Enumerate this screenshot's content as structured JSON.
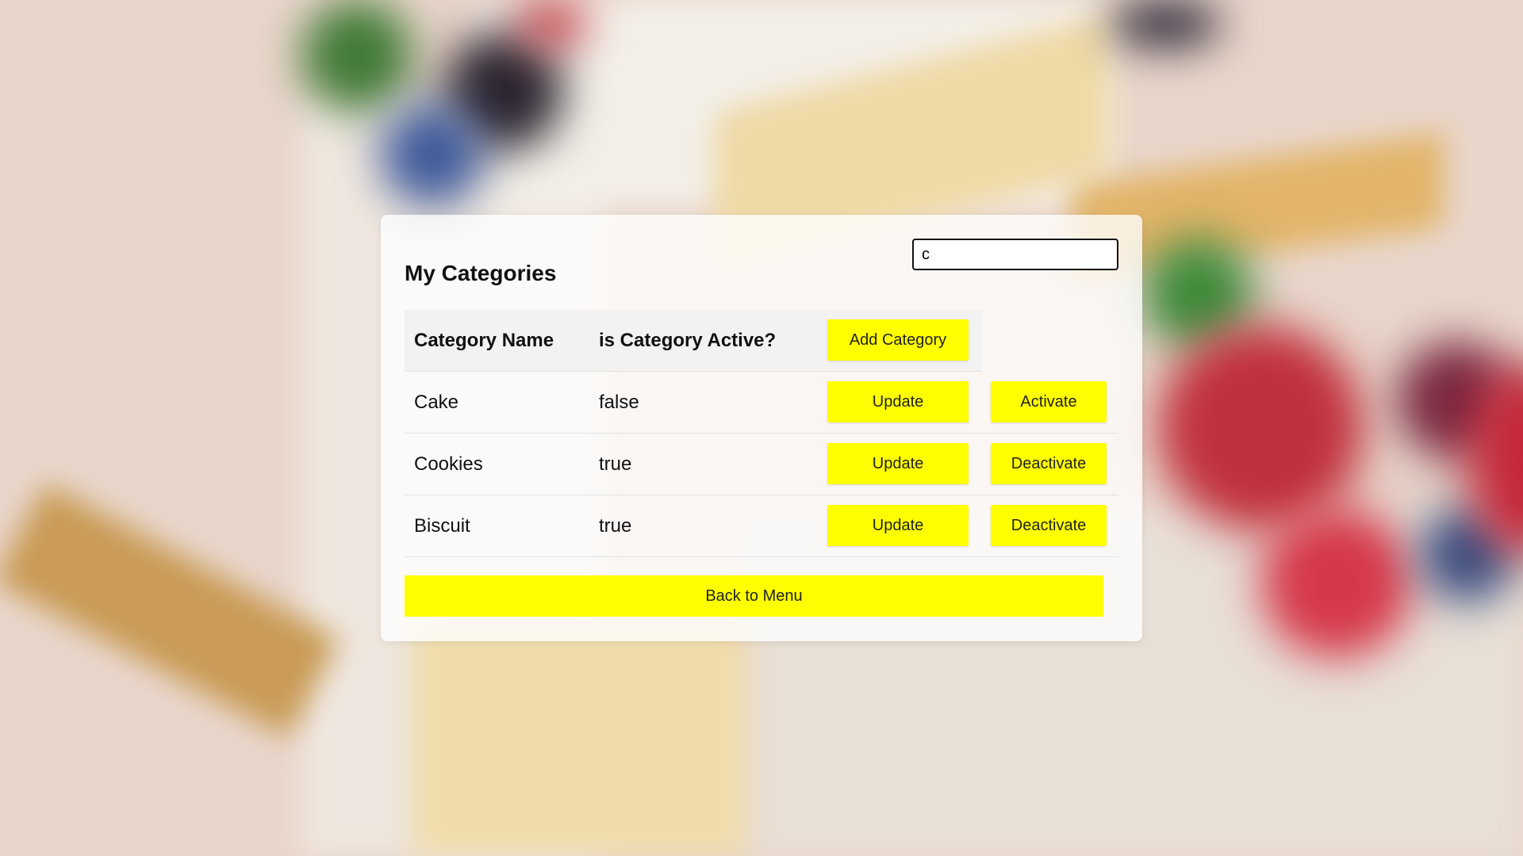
{
  "search": {
    "value": "c",
    "placeholder": ""
  },
  "page": {
    "title": "My Categories"
  },
  "table": {
    "headers": {
      "name": "Category Name",
      "active": "is Category Active?",
      "add_label": "Add Category"
    },
    "rows": [
      {
        "name": "Cake",
        "active": "false",
        "update_label": "Update",
        "toggle_label": "Activate"
      },
      {
        "name": "Cookies",
        "active": "true",
        "update_label": "Update",
        "toggle_label": "Deactivate"
      },
      {
        "name": "Biscuit",
        "active": "true",
        "update_label": "Update",
        "toggle_label": "Deactivate"
      }
    ]
  },
  "footer": {
    "back_label": "Back to Menu"
  },
  "colors": {
    "button": "#ffff00",
    "card": "#ffffff"
  }
}
